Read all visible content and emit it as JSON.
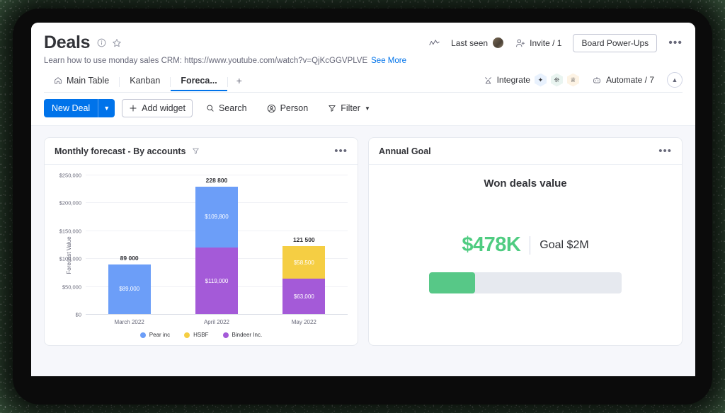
{
  "header": {
    "board_title": "Deals",
    "info_icon": "info-icon",
    "star_icon": "star-icon",
    "subtitle": "Learn how to use monday sales CRM: https://www.youtube.com/watch?v=QjKcGGVPLVE",
    "see_more": "See More",
    "activity_icon": "activity-graph-icon",
    "last_seen": "Last seen",
    "invite_icon": "person-add-icon",
    "invite": "Invite / 1",
    "power_ups": "Board Power-Ups",
    "more_menu": "•••"
  },
  "tabs": {
    "items": [
      {
        "label": "Main Table",
        "icon": "home-icon",
        "active": false
      },
      {
        "label": "Kanban",
        "icon": "",
        "active": false
      },
      {
        "label": "Foreca...",
        "icon": "",
        "active": true
      }
    ],
    "add_label": "+",
    "integrate_icon": "integrate-icon",
    "integrate": "Integrate",
    "apps": [
      "app-hex-blue-icon",
      "app-hex-green-icon",
      "app-hex-orange-icon"
    ],
    "automate_icon": "robot-icon",
    "automate": "Automate / 7",
    "collapse_icon": "chevron-up-icon"
  },
  "actionbar": {
    "new_deal": "New Deal",
    "new_deal_caret": "chevron-down-icon",
    "add_widget": "Add widget",
    "add_widget_icon": "plus-icon",
    "search": "Search",
    "search_icon": "search-icon",
    "person": "Person",
    "person_icon": "person-circle-icon",
    "filter": "Filter",
    "filter_icon": "funnel-icon",
    "filter_caret": "chevron-down-icon"
  },
  "chart_widget": {
    "title": "Monthly forecast - By accounts",
    "filter_icon": "funnel-icon",
    "menu": "•••"
  },
  "goal_widget": {
    "title": "Annual Goal",
    "menu": "•••",
    "heading": "Won deals value",
    "value": "$478K",
    "goal": "Goal $2M",
    "progress_percent": 23.9,
    "fill_color": "#57c887",
    "track_color": "#e6e9ef"
  },
  "chart_data": {
    "type": "bar",
    "stacked": true,
    "title": "Monthly forecast - By accounts",
    "xlabel": "",
    "ylabel": "Forecast Value",
    "categories": [
      "March 2022",
      "April 2022",
      "May 2022"
    ],
    "ylim": [
      0,
      250000
    ],
    "yticks": [
      "$0",
      "$50,000",
      "$100,000",
      "$150,000",
      "$200,000",
      "$250,000"
    ],
    "ytick_values": [
      0,
      50000,
      100000,
      150000,
      200000,
      250000
    ],
    "grid": true,
    "legend_position": "bottom",
    "series": [
      {
        "name": "Pear inc",
        "color": "#6c9ef8",
        "values": [
          89000,
          109800,
          0
        ]
      },
      {
        "name": "HSBF",
        "color": "#f5ce43",
        "values": [
          0,
          0,
          58500
        ]
      },
      {
        "name": "Bindeer Inc.",
        "color": "#a45ad8",
        "values": [
          0,
          119000,
          63000
        ]
      }
    ],
    "totals": [
      "89 000",
      "228 800",
      "121 500"
    ],
    "total_values": [
      89000,
      228800,
      121500
    ],
    "bars": [
      {
        "category": "March 2022",
        "total_label": "89 000",
        "total": 89000,
        "segments": [
          {
            "series": "Pear inc",
            "label": "$89,000",
            "value": 89000,
            "color": "#6c9ef8"
          }
        ]
      },
      {
        "category": "April 2022",
        "total_label": "228 800",
        "total": 228800,
        "segments": [
          {
            "series": "Pear inc",
            "label": "$109,800",
            "value": 109800,
            "color": "#6c9ef8"
          },
          {
            "series": "Bindeer Inc.",
            "label": "$119,000",
            "value": 119000,
            "color": "#a45ad8"
          }
        ]
      },
      {
        "category": "May 2022",
        "total_label": "121 500",
        "total": 121500,
        "segments": [
          {
            "series": "HSBF",
            "label": "$58,500",
            "value": 58500,
            "color": "#f5ce43"
          },
          {
            "series": "Bindeer Inc.",
            "label": "$63,000",
            "value": 63000,
            "color": "#a45ad8"
          }
        ]
      }
    ]
  }
}
